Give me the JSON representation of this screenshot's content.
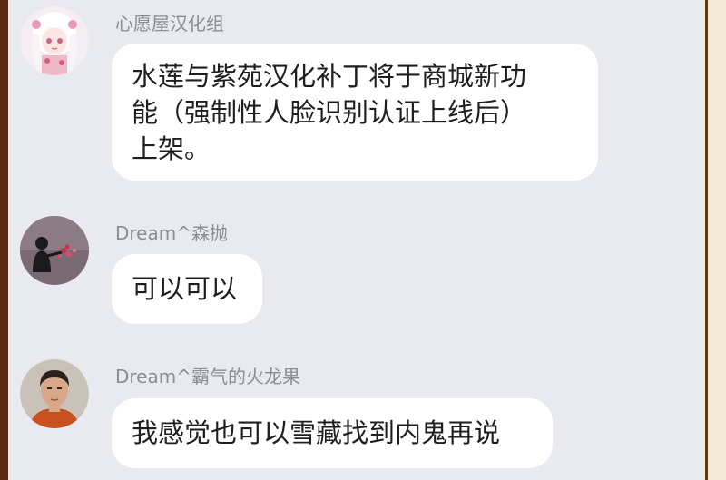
{
  "messages": [
    {
      "sender": "心愿屋汉化组",
      "avatar_icon": "anime-girl-avatar-icon",
      "lines": [
        "水莲与紫苑汉化补丁将于商城新功",
        "能（强制性人脸识别认证上线后）",
        "上架。"
      ]
    },
    {
      "sender": "Dream^森抛",
      "avatar_icon": "silhouette-flowers-avatar-icon",
      "lines": [
        "可以可以"
      ]
    },
    {
      "sender": "Dream^霸气的火龙果",
      "avatar_icon": "man-portrait-avatar-icon",
      "lines": [
        "我感觉也可以雪藏找到内鬼再说"
      ]
    }
  ],
  "colors": {
    "background": "#e9eaef",
    "bubble": "#ffffff",
    "sender_text": "#8a8d94",
    "message_text": "#1e1e1e",
    "frame_left": "#5b2a14",
    "frame_right": "#f3ead6"
  }
}
